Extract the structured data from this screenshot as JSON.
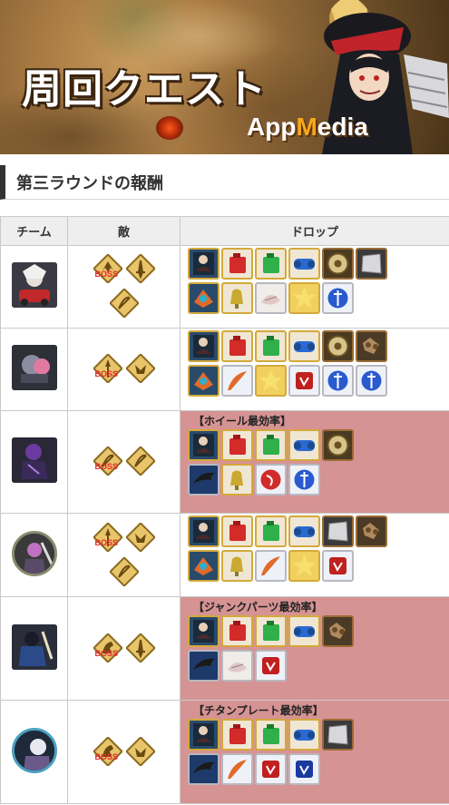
{
  "banner": {
    "title": "周回クエスト",
    "brand_a": "App",
    "brand_m": "M",
    "brand_b": "edia"
  },
  "section": {
    "title": "第三ラウンドの報酬"
  },
  "table": {
    "headers": {
      "team": "チーム",
      "enemy": "敵",
      "drops": "ドロップ"
    },
    "boss_label": "BOSS",
    "rows": [
      {
        "caption": "",
        "highlight": false
      },
      {
        "caption": "",
        "highlight": false
      },
      {
        "caption": "【ホイール最効率】",
        "highlight": true
      },
      {
        "caption": "",
        "highlight": false
      },
      {
        "caption": "【ジャンクパーツ最効率】",
        "highlight": true
      },
      {
        "caption": "【チタンプレート最効率】",
        "highlight": true
      }
    ]
  },
  "colors": {
    "highlight_row": "#d69393",
    "boss_red": "#e52b2b",
    "class_gold": "#c9a14a",
    "section_bar": "#333333"
  }
}
